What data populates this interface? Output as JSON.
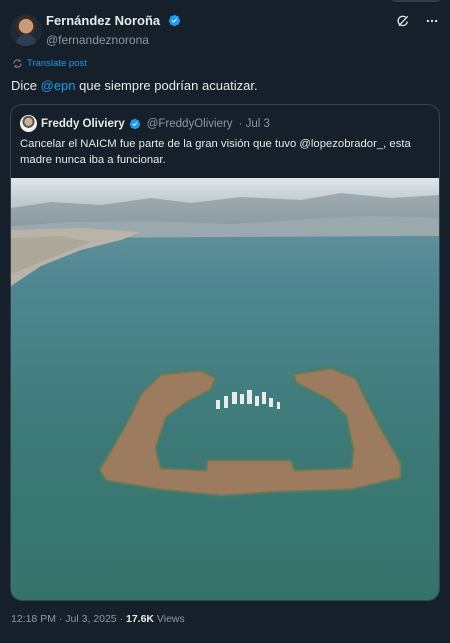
{
  "author": {
    "display_name": "Fernández Noroña",
    "handle": "@fernandeznorona"
  },
  "translate_label": "Translate post",
  "post": {
    "prefix": "Dice ",
    "mention": "@epn",
    "suffix": " que siempre podrían acuatizar."
  },
  "quoted": {
    "display_name": "Freddy Oliviery",
    "handle": "@FreddyOliviery",
    "date": "· Jul 3",
    "text": "Cancelar el NAICM fue parte de la gran visión que tuvo @lopezobrador_, esta madre nunca iba a funcionar."
  },
  "footer": {
    "time": "12:18 PM · Jul 3, 2025 · ",
    "views_count": "17.6K",
    "views_label": " Views"
  },
  "colors": {
    "background": "#15202b",
    "accent": "#1d9bf0",
    "secondary_text": "#8b98a5",
    "border": "#38444d"
  },
  "icons": [
    "verified-badge-icon",
    "grok-icon",
    "more-options-icon",
    "translate-icon"
  ]
}
